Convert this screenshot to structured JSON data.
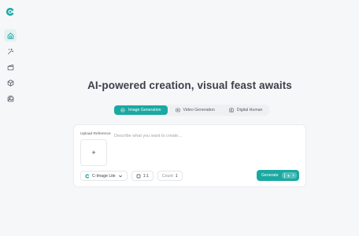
{
  "hero": {
    "headline": "AI-powered creation, visual feast awaits"
  },
  "tabs": [
    {
      "label": "Image Generation",
      "icon": "image-icon",
      "active": true
    },
    {
      "label": "Video Generation",
      "icon": "video-icon",
      "active": false
    },
    {
      "label": "Digital Human",
      "icon": "digital-human-icon",
      "active": false
    }
  ],
  "composer": {
    "upload_label": "Upload Reference",
    "upload_symbol": "+",
    "prompt_placeholder": "Describe what you want to create...",
    "model_label": "C-Image Lite",
    "aspect_label": "1:1",
    "count_label": "Count",
    "count_value": "1",
    "generate_label": "Generate",
    "cost_value": "1"
  },
  "colors": {
    "accent": "#1aa9a2",
    "accent_soft": "#e4f1f1",
    "background": "#f6f7f9"
  }
}
